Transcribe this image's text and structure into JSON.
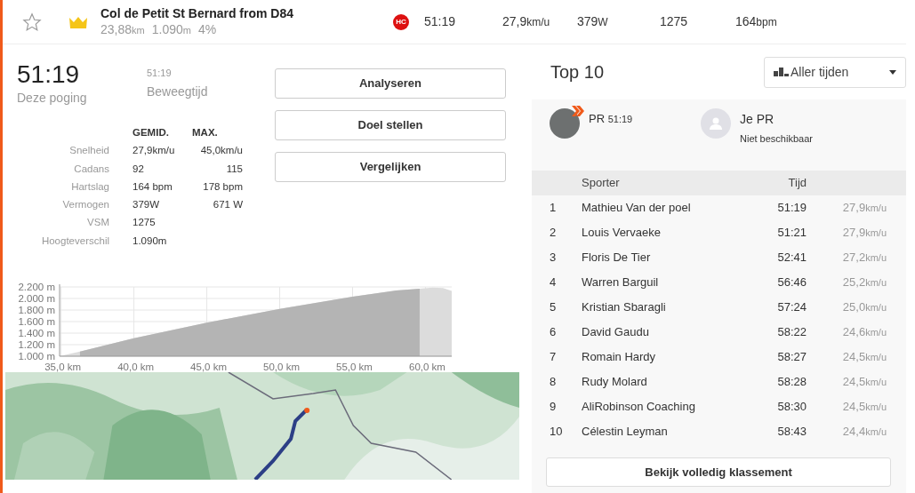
{
  "segment": {
    "starred": false,
    "title": "Col de Petit St Bernard from D84",
    "distance": {
      "value": "23,88",
      "unit": "km"
    },
    "elevation": {
      "value": "1.090",
      "unit": "m"
    },
    "grade": "4%",
    "category": "HC",
    "stats": [
      {
        "value": "51:19"
      },
      {
        "value": "27,9",
        "unit": "km/u"
      },
      {
        "value": "379",
        "unit": "W"
      },
      {
        "value": "1275"
      },
      {
        "value": "164",
        "unit": "bpm"
      }
    ]
  },
  "effort": {
    "time": "51:19",
    "time_label": "Deze poging",
    "moving_time": "51:19",
    "moving_label": "Beweegtijd",
    "columns": [
      "GEMID.",
      "MAX."
    ],
    "rows": [
      {
        "label": "Snelheid",
        "avg": "27,9km/u",
        "max": "45,0km/u"
      },
      {
        "label": "Cadans",
        "avg": "92",
        "max": "115"
      },
      {
        "label": "Hartslag",
        "avg": "164 bpm",
        "max": "178 bpm"
      },
      {
        "label": "Vermogen",
        "avg": "379W",
        "max": "671 W"
      },
      {
        "label": "VSM",
        "avg": "1275"
      },
      {
        "label": "Hoogteverschil",
        "avg": "1.090m"
      }
    ]
  },
  "actions": [
    "Analyseren",
    "Doel stellen",
    "Vergelijken"
  ],
  "elevation_chart": {
    "chart_data": {
      "type": "area",
      "x": [
        34.9,
        36.3,
        40,
        45,
        50,
        55,
        58,
        59.6,
        60.5,
        61.2,
        61.8
      ],
      "grid": true,
      "series": [
        {
          "color": "#dcdcdc",
          "values": [
            1000,
            1080,
            1310,
            1580,
            1820,
            2030,
            2140,
            2170,
            2190,
            2180,
            2130
          ]
        },
        {
          "color": "#b4b4b4",
          "values": [
            null,
            1080,
            1310,
            1580,
            1820,
            2030,
            2140,
            2170,
            null,
            null,
            null
          ]
        }
      ],
      "xlim": [
        34.9,
        61.8
      ],
      "ylim": [
        1000,
        2200
      ],
      "xticks": [
        {
          "value": 35,
          "label": "35,0 km"
        },
        {
          "value": 40,
          "label": "40,0 km"
        },
        {
          "value": 45,
          "label": "45,0 km"
        },
        {
          "value": 50,
          "label": "50,0 km"
        },
        {
          "value": 55,
          "label": "55,0 km"
        },
        {
          "value": 60,
          "label": "60,0 km"
        }
      ],
      "yticks": [
        {
          "value": 1000,
          "label": "1.000 m"
        },
        {
          "value": 1200,
          "label": "1.200 m"
        },
        {
          "value": 1400,
          "label": "1.400 m"
        },
        {
          "value": 1600,
          "label": "1.600 m"
        },
        {
          "value": 1800,
          "label": "1.800 m"
        },
        {
          "value": 2000,
          "label": "2.000 m"
        },
        {
          "value": 2200,
          "label": "2.200 m"
        }
      ]
    }
  },
  "leaderboard": {
    "title": "Top 10",
    "filter": "Aller tijden",
    "my_pr": {
      "label": "PR",
      "time": "51:19"
    },
    "your_pr": {
      "label": "Je PR",
      "value": "Niet beschikbaar"
    },
    "columns": [
      "Sporter",
      "Tijd"
    ],
    "rows": [
      {
        "rank": "1",
        "name": "Mathieu Van der poel",
        "time": "51:19",
        "speed": "27,9",
        "unit": "km/u"
      },
      {
        "rank": "2",
        "name": "Louis Vervaeke",
        "time": "51:21",
        "speed": "27,9",
        "unit": "km/u"
      },
      {
        "rank": "3",
        "name": "Floris De Tier",
        "time": "52:41",
        "speed": "27,2",
        "unit": "km/u"
      },
      {
        "rank": "4",
        "name": "Warren Barguil",
        "time": "56:46",
        "speed": "25,2",
        "unit": "km/u"
      },
      {
        "rank": "5",
        "name": "Kristian Sbaragli",
        "time": "57:24",
        "speed": "25,0",
        "unit": "km/u"
      },
      {
        "rank": "6",
        "name": "David Gaudu",
        "time": "58:22",
        "speed": "24,6",
        "unit": "km/u"
      },
      {
        "rank": "7",
        "name": "Romain Hardy",
        "time": "58:27",
        "speed": "24,5",
        "unit": "km/u"
      },
      {
        "rank": "8",
        "name": "Rudy Molard",
        "time": "58:28",
        "speed": "24,5",
        "unit": "km/u"
      },
      {
        "rank": "9",
        "name": "AliRobinson Coaching",
        "time": "58:30",
        "speed": "24,5",
        "unit": "km/u"
      },
      {
        "rank": "10",
        "name": "Célestin Leyman",
        "time": "58:43",
        "speed": "24,4",
        "unit": "km/u"
      }
    ],
    "full_button": "Bekijk volledig klassement"
  }
}
